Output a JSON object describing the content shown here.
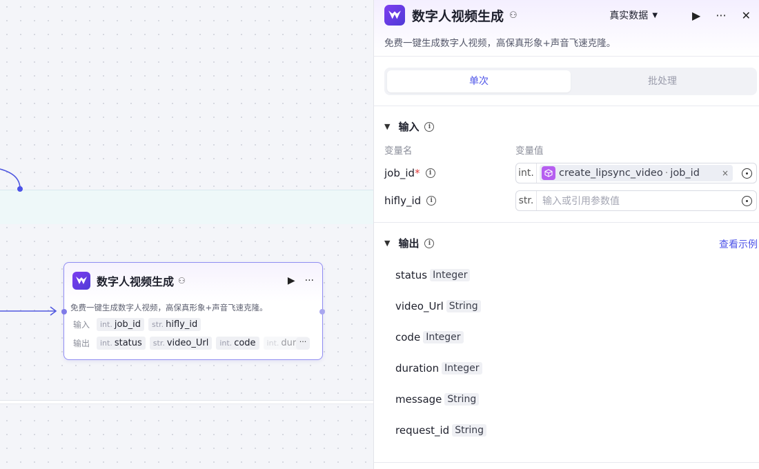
{
  "node": {
    "title": "数字人视频生成",
    "description": "免费一键生成数字人视频，高保真形象+声音飞速克隆。",
    "input_label": "输入",
    "output_label": "输出",
    "inputs": [
      {
        "type": "int.",
        "name": "job_id"
      },
      {
        "type": "str.",
        "name": "hifly_id"
      }
    ],
    "outputs": [
      {
        "type": "int.",
        "name": "status"
      },
      {
        "type": "str.",
        "name": "video_Url"
      },
      {
        "type": "int.",
        "name": "code"
      },
      {
        "type": "int.",
        "name": "durat"
      }
    ],
    "more": "···"
  },
  "panel": {
    "title": "数字人视频生成",
    "data_select": "真实数据",
    "description": "免费一键生成数字人视频，高保真形象+声音飞速克隆。",
    "tabs": [
      "单次",
      "批处理"
    ],
    "input_section": "输入",
    "col_name": "变量名",
    "col_value": "变量值",
    "inputs": [
      {
        "name": "job_id",
        "required": "*",
        "type": "int.",
        "ref_node": "create_lipsync_video",
        "ref_sep": "·",
        "ref_var": "job_id",
        "clear": "×"
      },
      {
        "name": "hifly_id",
        "type": "str.",
        "placeholder": "输入或引用参数值"
      }
    ],
    "output_section": "输出",
    "example_link": "查看示例",
    "outputs": [
      {
        "name": "status",
        "type": "Integer"
      },
      {
        "name": "video_Url",
        "type": "String"
      },
      {
        "name": "code",
        "type": "Integer"
      },
      {
        "name": "duration",
        "type": "Integer"
      },
      {
        "name": "message",
        "type": "String"
      },
      {
        "name": "request_id",
        "type": "String"
      }
    ]
  },
  "colors": {
    "accent": "#4d53e8",
    "node_border": "#8f8cf2",
    "required": "#e03a3a"
  }
}
